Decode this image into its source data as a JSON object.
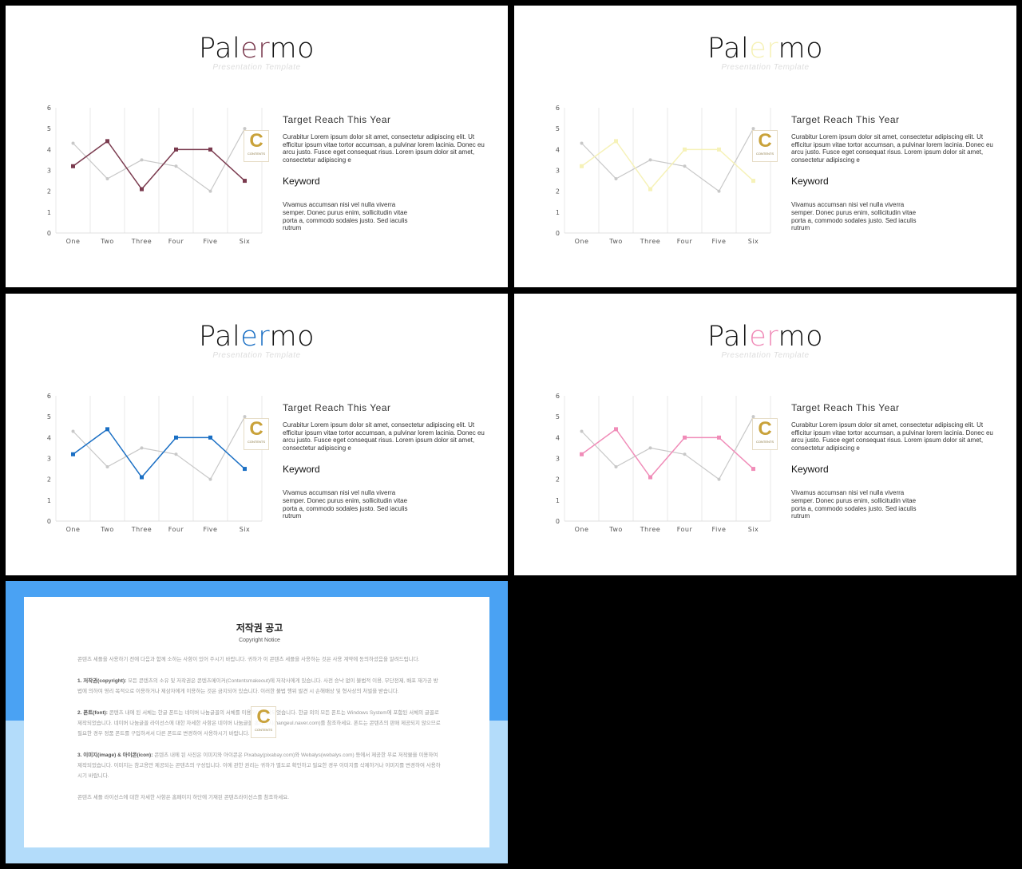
{
  "slides": [
    {
      "title_pre": "Pal",
      "title_accent": "er",
      "title_post": "mo",
      "subtitle": "Presentation Template",
      "accent": "#7a3a4e"
    },
    {
      "title_pre": "Pal",
      "title_accent": "er",
      "title_post": "mo",
      "subtitle": "Presentation Template",
      "accent": "#f6f2b8"
    },
    {
      "title_pre": "Pal",
      "title_accent": "er",
      "title_post": "mo",
      "subtitle": "Presentation Template",
      "accent": "#1a6fc4"
    },
    {
      "title_pre": "Pal",
      "title_accent": "er",
      "title_post": "mo",
      "subtitle": "Presentation Template",
      "accent": "#f08cb8"
    }
  ],
  "text": {
    "heading": "Target Reach This Year",
    "body": "Curabitur Lorem ipsum dolor sit amet, consectetur adipiscing elit. Ut efficitur ipsum vitae tortor accumsan, a pulvinar lorem lacinia. Donec eu arcu justo. Fusce eget consequat risus. Lorem ipsum dolor sit amet, consectetur adipiscing e",
    "keyword": "Keyword",
    "keyword_body": "Vivamus accumsan nisi vel nulla viverra semper. Donec purus enim, sollicitudin vitae porta a, commodo sodales justo. Sed iaculis rutrum"
  },
  "logo": {
    "letter": "C",
    "text": "CONTENTS"
  },
  "chart_data": {
    "type": "line",
    "categories": [
      "One",
      "Two",
      "Three",
      "Four",
      "Five",
      "Six"
    ],
    "ylim": [
      0,
      6
    ],
    "yticks": [
      0,
      1,
      2,
      3,
      4,
      5,
      6
    ],
    "grid": "vertical",
    "series": [
      {
        "values": [
          4.3,
          2.6,
          3.5,
          3.2,
          2.0,
          5.0
        ],
        "color": "#c8c8c8"
      },
      {
        "values": [
          3.2,
          4.4,
          2.1,
          4.0,
          4.0,
          2.5
        ],
        "color": "accent"
      }
    ]
  },
  "notice": {
    "title": "저작권 공고",
    "subtitle": "Copyright Notice",
    "intro": "콘텐츠 세플을 사용하기 전에 다음과 함께 소하는 사항이 있어 주시기 바랍니다. 귀하가 이 콘텐츠 세플을 사용하는 것은 사용 계약에 동의하셨음을 알려드립니다.",
    "p1_label": "1. 저작권(copyright):",
    "p1": "모든 콘텐츠의 소유 및 저작권은 콘텐츠메이커(Contentsmakeout)에 저작사에게 있습니다. 사전 승낙 없이 불법적 이용, 무단전제, 배포 재가공 방법에 의하여 영리 목적으로 이용하거나 제삼자에게 이용하는 것은 금지되어 있습니다. 이러한 불법 행위 발견 시 손해배상 및 형사상의 처벌을 받습니다.",
    "p2_label": "2. 폰트(font):",
    "p2": "콘텐츠 내에 된 서체는 한글 폰트는 네이버 나눔글꼴의 서체를 이용하여 제작되었습니다. 한글 외의 모든 폰트는 Windows System에 포함된 서체의 글꼴로 제작되었습니다. 네이버 나눔글꼴 라이선스에 대한 자세한 사항은 네이버 나눔글꼴 홈페이지(hangeul.naver.com)를 참조하세요. 폰트는 콘텐츠의 판매 제공되지 않으므로 필요한 경우 정품 폰트를 구입하셔서 다른 폰트로 변경하여 사용하시기 바랍니다.",
    "p3_label": "3. 이미지(image) & 아이콘(icon):",
    "p3": "콘텐츠 내에 된 사진은 이미지와 아이콘은 Pixabay(pixabay.com)와 Webalys(webalys.com) 등에서 제공한 무료 저작물을 이용하여 제작되었습니다. 이미지는 참고용만 제공되는 콘텐츠의 구성입니다. 이에 관한 권리는 귀하가 별도로 확인하고 필요한 경우 이미지를 삭제하거나 이미지를 변경하여 사용하시기 바랍니다.",
    "outro": "콘텐츠 세플 라이선스에 대한 자세한 사항은 홈페이지 하단에 기재된 콘텐츠라이선스를 참조하세요."
  }
}
